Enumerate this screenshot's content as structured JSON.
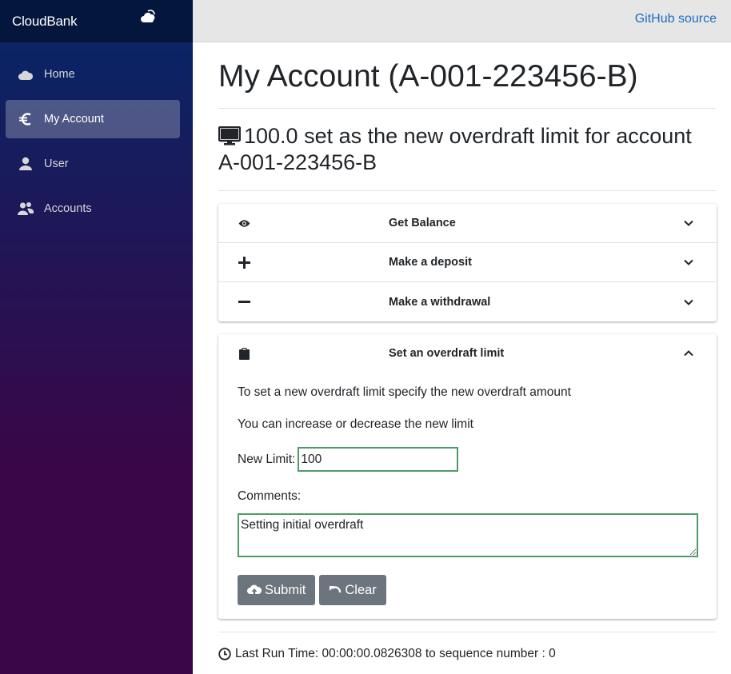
{
  "sidebar": {
    "brand": "CloudBank",
    "items": [
      {
        "label": "Home",
        "icon": "cloud-icon"
      },
      {
        "label": "My Account",
        "icon": "euro-icon",
        "active": true
      },
      {
        "label": "User",
        "icon": "person-icon"
      },
      {
        "label": "Accounts",
        "icon": "people-icon"
      }
    ]
  },
  "topbar": {
    "github_link": "GitHub source"
  },
  "main": {
    "title": "My Account (A-001-223456-B)",
    "status_message": "100.0 set as the new overdraft limit for account A-001-223456-B",
    "accordion": [
      {
        "label": "Get Balance",
        "icon": "eye-icon"
      },
      {
        "label": "Make a deposit",
        "icon": "plus-icon"
      },
      {
        "label": "Make a withdrawal",
        "icon": "minus-icon"
      }
    ],
    "overdraft": {
      "label": "Set an overdraft limit",
      "icon": "clipboard-icon",
      "intro": "To set a new overdraft limit specify the new overdraft amount",
      "hint": "You can increase or decrease the new limit",
      "limit_label": "New Limit:",
      "limit_value": "100",
      "comments_label": "Comments:",
      "comments_value": "Setting initial overdraft",
      "submit_label": "Submit",
      "clear_label": "Clear"
    },
    "footer": "Last Run Time: 00:00:00.0826308 to sequence number : 0"
  },
  "colors": {
    "sidebar_top": "#052767",
    "sidebar_bottom": "#3a0647",
    "link": "#1b6ec2",
    "button": "#6c757d",
    "input_border": "#4e9a6c"
  }
}
